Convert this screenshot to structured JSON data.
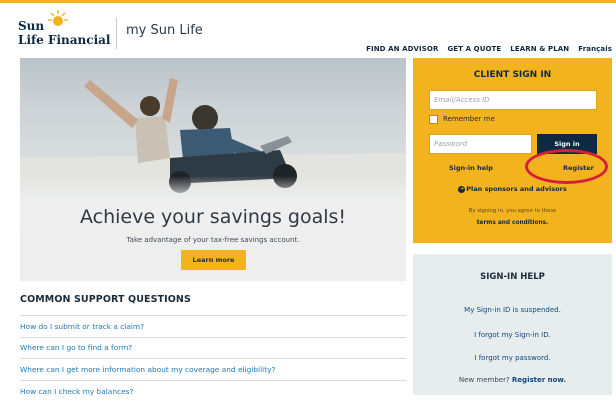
{
  "brand": {
    "logo_line1": "Sun",
    "logo_line2": "Life Financial",
    "title": "my Sun Life"
  },
  "nav": {
    "items": [
      "FIND AN ADVISOR",
      "GET A QUOTE",
      "LEARN & PLAN",
      "Français"
    ]
  },
  "hero": {
    "heading": "Achieve your savings goals!",
    "subheading": "Take advantage of your tax-free savings account.",
    "button_label": "Learn more"
  },
  "support": {
    "title": "COMMON SUPPORT QUESTIONS",
    "questions": [
      "How do I submit or track a claim?",
      "Where can I go to find a form?",
      "Where can I get more information about my coverage and eligibility?",
      "How can I check my balances?"
    ]
  },
  "signin": {
    "title": "CLIENT SIGN IN",
    "email_placeholder": "Email/Access ID",
    "remember_label": "Remember me",
    "password_placeholder": "Password",
    "button_label": "Sign in",
    "help_link": "Sign-in help",
    "register_link": "Register",
    "plan_link": "Plan sponsors and advisors",
    "agree_text": "By signing in, you agree to these",
    "terms_link": "terms and conditions."
  },
  "help": {
    "title": "SIGN-IN HELP",
    "items": [
      "My Sign-in ID is suspended.",
      "I forgot my Sign-in ID.",
      "I forgot my password."
    ],
    "new_member_text": "New member?",
    "register_now": "Register now."
  },
  "colors": {
    "accent_gold": "#f2b31e",
    "navy": "#0e2a43",
    "link_blue": "#1e78b4",
    "highlight_red": "#d6203b",
    "help_bg": "#e7ecee"
  },
  "icons": {
    "logo": "sun-logo-icon",
    "plan": "circle-arrow-icon",
    "checkbox": "checkbox-unchecked"
  }
}
